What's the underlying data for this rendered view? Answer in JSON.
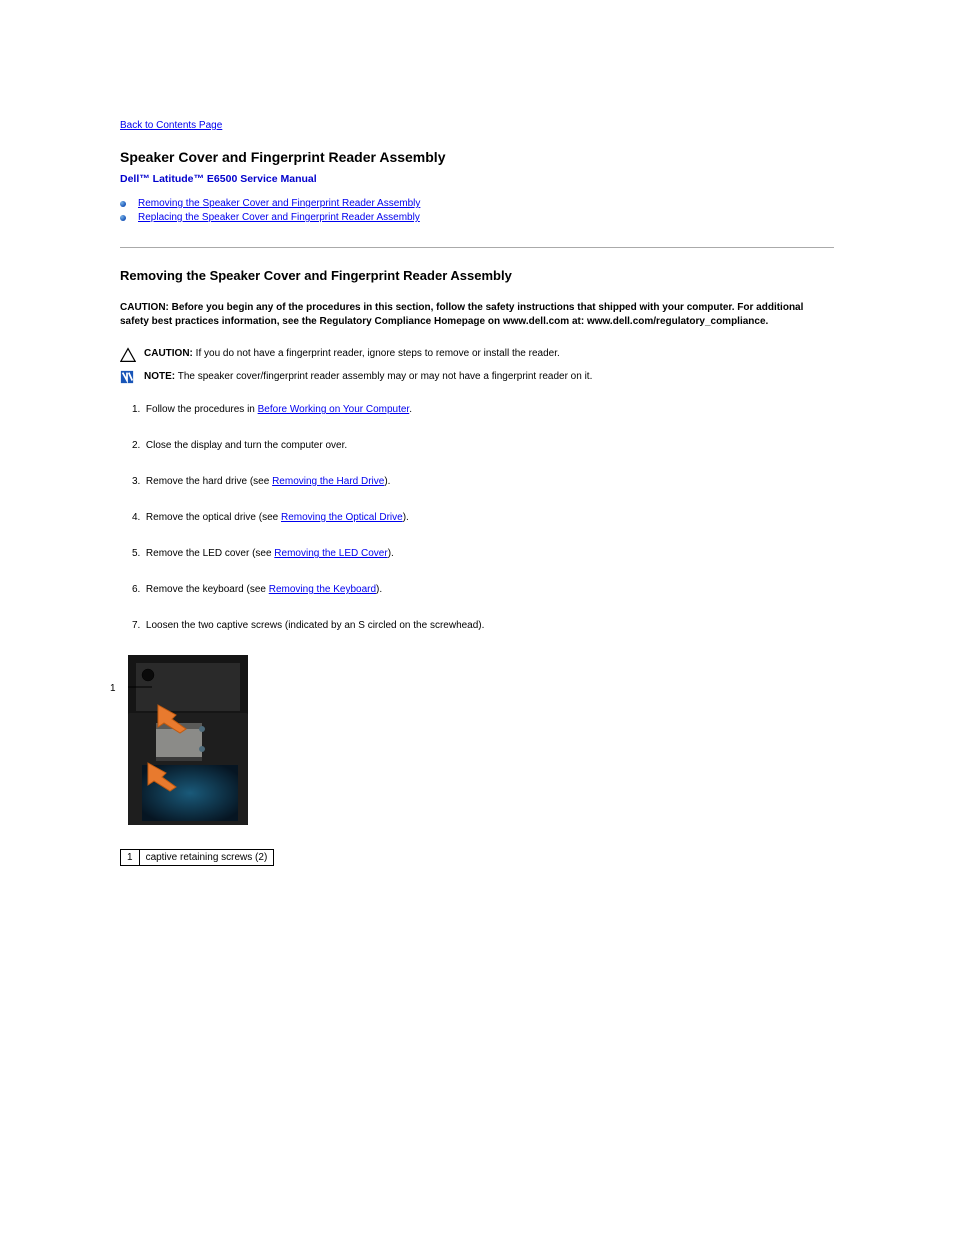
{
  "back_link": "Back to Contents Page",
  "page_title": "Speaker Cover and Fingerprint Reader Assembly",
  "subtitle": "Dell™ Latitude™ E6500 Service Manual",
  "toc": [
    "Removing the Speaker Cover and Fingerprint Reader Assembly",
    "Replacing the Speaker Cover and Fingerprint Reader Assembly"
  ],
  "section_heading": "Removing the Speaker Cover and Fingerprint Reader Assembly",
  "caution_main": "CAUTION: Before you begin any of the procedures in this section, follow the safety instructions that shipped with your computer. For additional safety best practices information, see the Regulatory Compliance Homepage on www.dell.com at: www.dell.com/regulatory_compliance.",
  "caution2": {
    "label": "CAUTION:",
    "text": " If you do not have a fingerprint reader, ignore steps to remove or install the reader."
  },
  "note": {
    "label": "NOTE:",
    "text": " The speaker cover/fingerprint reader assembly may or may not have a fingerprint reader on it."
  },
  "steps": [
    {
      "n": "1.",
      "pre": "Follow the procedures in ",
      "link": "Before Working on Your Computer",
      "post": "."
    },
    {
      "n": "2.",
      "pre": "Close the display and turn the computer over.",
      "link": "",
      "post": ""
    },
    {
      "n": "3.",
      "pre": "Remove the hard drive (see ",
      "link": "Removing the Hard Drive",
      "post": ")."
    },
    {
      "n": "4.",
      "pre": "Remove the optical drive (see ",
      "link": "Removing the Optical Drive",
      "post": ")."
    },
    {
      "n": "5.",
      "pre": "Remove the LED cover (see ",
      "link": "Removing the LED Cover",
      "post": ")."
    },
    {
      "n": "6.",
      "pre": "Remove the keyboard (see ",
      "link": "Removing the Keyboard",
      "post": ")."
    },
    {
      "n": "7.",
      "pre": "Loosen the two captive screws (indicated by an S circled on the screwhead).",
      "link": "",
      "post": ""
    }
  ],
  "legend": {
    "n": "1",
    "text": "captive retaining screws (2)"
  }
}
